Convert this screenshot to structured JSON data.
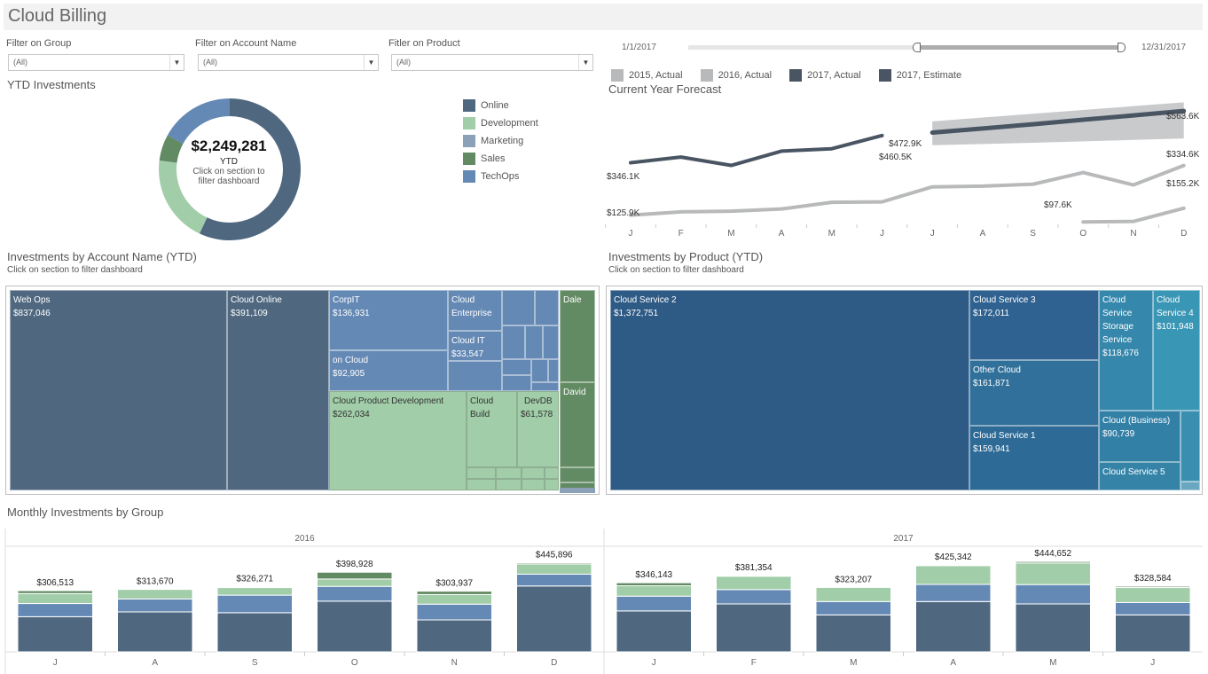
{
  "app": {
    "title": "Cloud Billing"
  },
  "filters": [
    {
      "label": "Filter on Group",
      "value": "(All)"
    },
    {
      "label": "Filter on Account Name",
      "value": "(All)"
    },
    {
      "label": "Fitler on Product",
      "value": "(All)"
    }
  ],
  "date_slider": {
    "start_label": "1/1/2017",
    "end_label": "12/31/2017",
    "selected_start_fraction": 0.5,
    "selected_end_fraction": 1.0
  },
  "colors": {
    "online": "#4f6880",
    "development": "#a1cda8",
    "marketing": "#8aa1b8",
    "sales": "#628a63",
    "techops": "#6589b5",
    "actual_2017": "#4a5563",
    "prior_years": "#b8b9ba",
    "forecast_band": "#c9cacc",
    "product_dark": "#2e5a86",
    "product_mid": "#30709a",
    "product_light": "#3a8fb0"
  },
  "ytd": {
    "title": "YTD Investments",
    "total": "$2,249,281",
    "caption": "YTD",
    "hint_line1": "Click on section to",
    "hint_line2": "filter dashboard",
    "legend": [
      {
        "key": "online",
        "label": "Online"
      },
      {
        "key": "development",
        "label": "Development"
      },
      {
        "key": "marketing",
        "label": "Marketing"
      },
      {
        "key": "sales",
        "label": "Sales"
      },
      {
        "key": "techops",
        "label": "TechOps"
      }
    ]
  },
  "forecast": {
    "title": "Current Year Forecast",
    "legend": [
      {
        "label": "2015, Actual",
        "color": "#b8b9ba"
      },
      {
        "label": "2016, Actual",
        "color": "#b8b9ba"
      },
      {
        "label": "2017, Actual",
        "color": "#4a5563"
      },
      {
        "label": "2017, Estimate",
        "color": "#4a5563"
      }
    ],
    "labels": {
      "a2017_start": "$346.1K",
      "a2017_end": "$460.5K",
      "est_start": "$472.9K",
      "est_end": "$563.6K",
      "a2016_start": "$125.9K",
      "a2016_end": "$334.6K",
      "a2015_start": "$97.6K",
      "a2015_end": "$155.2K"
    }
  },
  "accounts": {
    "title": "Investments by Account Name (YTD)",
    "subtitle": "Click on section to filter dashboard",
    "cells": [
      {
        "name": "Web Ops",
        "value": "$837,046"
      },
      {
        "name": "Cloud  Online",
        "value": "$391,109"
      },
      {
        "name": "CorpIT",
        "value": "$136,931"
      },
      {
        "name": "Cloud Enterprise",
        "value": ""
      },
      {
        "name": "Cloud  IT",
        "value": "$33,547"
      },
      {
        "name": " on Cloud",
        "value": "$92,905"
      },
      {
        "name": "Cloud  Product Development",
        "value": "$262,034"
      },
      {
        "name": "Cloud Build",
        "value": ""
      },
      {
        "name": "DevDB",
        "value": "$61,578"
      },
      {
        "name": "Dale",
        "value": ""
      },
      {
        "name": "David",
        "value": ""
      }
    ]
  },
  "products": {
    "title": "Investments by Product (YTD)",
    "subtitle": "Click on section to filter dashboard",
    "cells": [
      {
        "name": "Cloud Service 2",
        "value": "$1,372,751"
      },
      {
        "name": "Cloud Service 3",
        "value": "$172,011"
      },
      {
        "name": "Other Cloud",
        "value": "$161,871"
      },
      {
        "name": "Cloud Service 1",
        "value": "$159,941"
      },
      {
        "name": "Cloud Service Storage Service",
        "value": "$118,676"
      },
      {
        "name": "Cloud Service 4",
        "value": "$101,948"
      },
      {
        "name": "Cloud  (Business)",
        "value": "$90,739"
      },
      {
        "name": "Cloud Service 5",
        "value": ""
      }
    ]
  },
  "chart_data": [
    {
      "type": "pie",
      "title": "YTD Investments",
      "center_label": "$2,249,281",
      "categories": [
        "Online",
        "Development",
        "Sales",
        "TechOps",
        "Marketing"
      ],
      "values_fraction": [
        0.57,
        0.2,
        0.06,
        0.17,
        0.0
      ]
    },
    {
      "type": "line",
      "title": "Current Year Forecast",
      "x": [
        "J",
        "F",
        "M",
        "A",
        "M",
        "J",
        "J",
        "A",
        "S",
        "O",
        "N",
        "D"
      ],
      "series": [
        {
          "name": "2017, Actual",
          "values": [
            346.1,
            370,
            335,
            395,
            405,
            460.5,
            null,
            null,
            null,
            null,
            null,
            null
          ]
        },
        {
          "name": "2017, Estimate",
          "values": [
            null,
            null,
            null,
            null,
            null,
            null,
            472.9,
            490,
            508,
            527,
            545,
            563.6
          ],
          "band_low": [
            null,
            null,
            null,
            null,
            null,
            null,
            420,
            425,
            430,
            436,
            442,
            448
          ],
          "band_high": [
            null,
            null,
            null,
            null,
            null,
            null,
            520,
            536,
            552,
            568,
            584,
            600
          ]
        },
        {
          "name": "2016, Actual",
          "values": [
            125.9,
            140,
            143,
            152,
            180,
            182,
            245,
            248,
            256,
            305,
            253,
            334.6
          ]
        },
        {
          "name": "2015, Actual",
          "values": [
            null,
            null,
            null,
            null,
            null,
            null,
            null,
            null,
            null,
            97.6,
            100,
            155.2
          ]
        }
      ],
      "unit": "$K",
      "ylim": [
        80,
        620
      ]
    },
    {
      "type": "bar",
      "title": "Monthly Investments by Group",
      "stacked": true,
      "panels": [
        {
          "name": "2016",
          "categories": [
            "J",
            "A",
            "S",
            "O",
            "N",
            "D"
          ],
          "totals": [
            "$306,513",
            "$313,670",
            "$326,271",
            "$398,928",
            "$303,937",
            "$445,896"
          ],
          "series": [
            {
              "name": "Online",
              "values": [
                176000,
                200000,
                196000,
                254000,
                160000,
                330000
              ]
            },
            {
              "name": "TechOps",
              "values": [
                66000,
                65000,
                88000,
                74000,
                79000,
                59000
              ]
            },
            {
              "name": "Development",
              "values": [
                50000,
                48000,
                38000,
                37000,
                48000,
                51000
              ]
            },
            {
              "name": "Sales",
              "values": [
                14513,
                1000,
                4271,
                33928,
                16937,
                5896
              ]
            }
          ]
        },
        {
          "name": "2017",
          "categories": [
            "J",
            "F",
            "M",
            "A",
            "M",
            "J"
          ],
          "totals": [
            "$346,143",
            "$381,354",
            "$323,207",
            "$425,342",
            "$444,652",
            "$328,584"
          ],
          "series": [
            {
              "name": "Online",
              "values": [
                205000,
                240000,
                185000,
                252000,
                240000,
                185000
              ]
            },
            {
              "name": "TechOps",
              "values": [
                74000,
                72000,
                67000,
                86000,
                97000,
                62000
              ]
            },
            {
              "name": "Development",
              "values": [
                52000,
                67000,
                71000,
                94000,
                108000,
                75000
              ]
            },
            {
              "name": "Sales",
              "values": [
                15143,
                2354,
                207,
                3342,
                7652,
                6584
              ]
            }
          ]
        }
      ]
    }
  ]
}
